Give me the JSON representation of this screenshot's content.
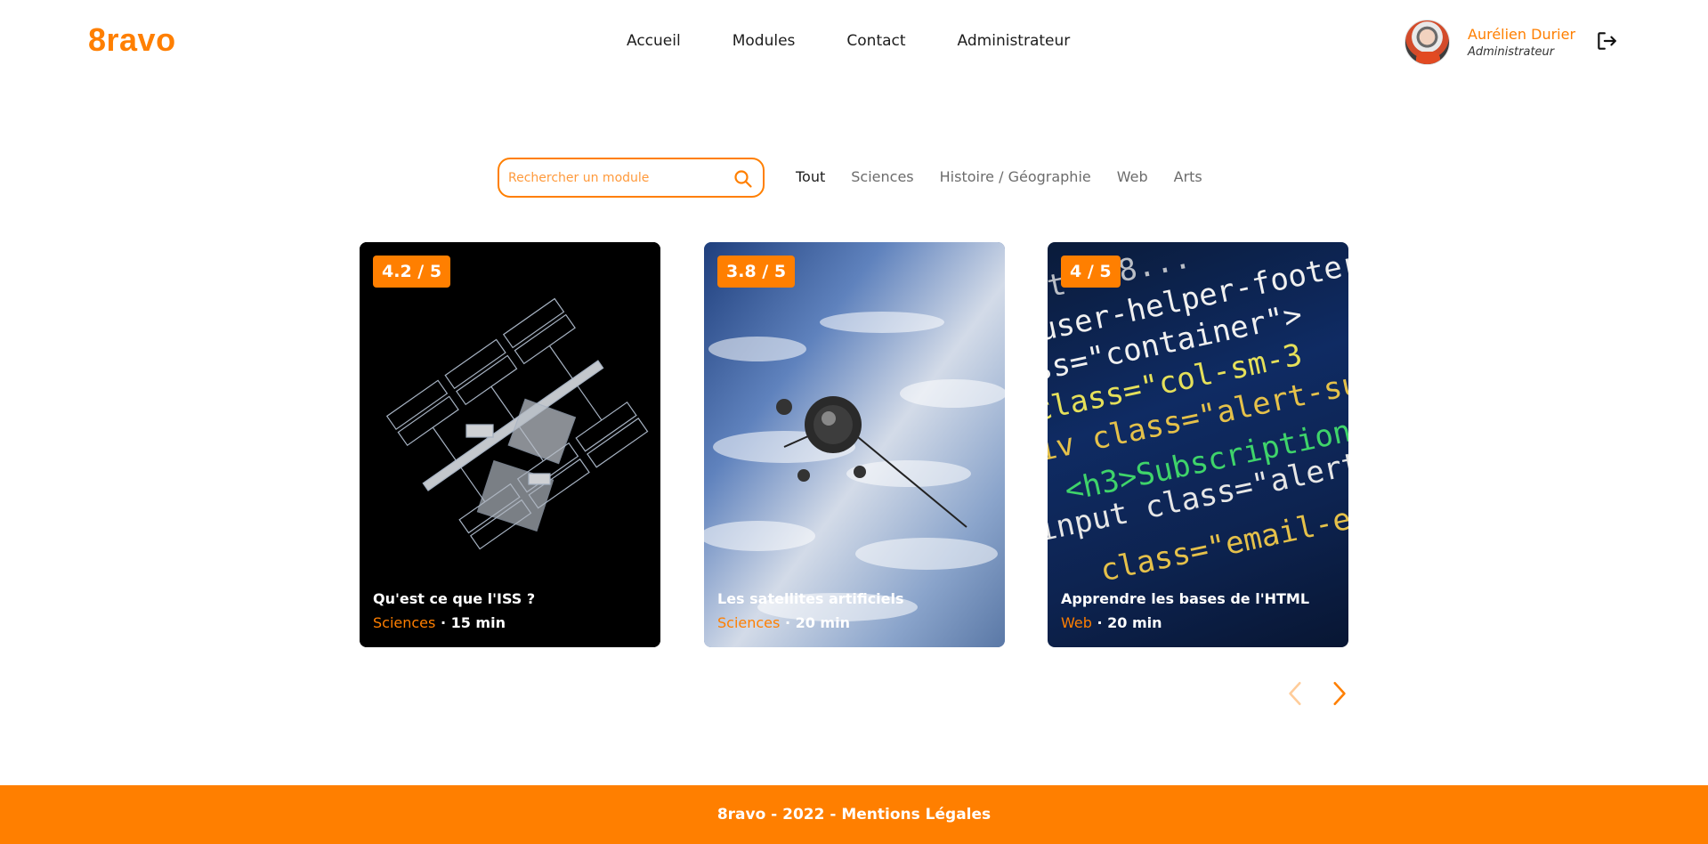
{
  "brand": {
    "logo": "8ravo",
    "accent": "#ff7f00"
  },
  "nav": {
    "items": [
      "Accueil",
      "Modules",
      "Contact",
      "Administrateur"
    ]
  },
  "user": {
    "name": "Aurélien Durier",
    "role": "Administrateur",
    "logout_icon": "logout-icon"
  },
  "search": {
    "placeholder": "Rechercher un module",
    "icon": "search-icon"
  },
  "categories": {
    "items": [
      "Tout",
      "Sciences",
      "Histoire / Géographie",
      "Web",
      "Arts"
    ],
    "active": "Tout"
  },
  "cards": [
    {
      "rating": "4.2 / 5",
      "title": "Qu'est ce que l'ISS ?",
      "category": "Sciences",
      "duration": "· 15 min",
      "image": "space-station-image"
    },
    {
      "rating": "3.8 / 5",
      "title": "Les satellites artificiels",
      "category": "Sciences",
      "duration": "· 20 min",
      "image": "satellite-image"
    },
    {
      "rating": "4 / 5",
      "title": "Apprendre les bases de l'HTML",
      "category": "Web",
      "duration": "· 20 min",
      "image": "html-code-image"
    }
  ],
  "pagination": {
    "prev_icon": "chevron-left-icon",
    "next_icon": "chevron-right-icon"
  },
  "footer": {
    "text": "8ravo - 2022 - Mentions Légales"
  }
}
